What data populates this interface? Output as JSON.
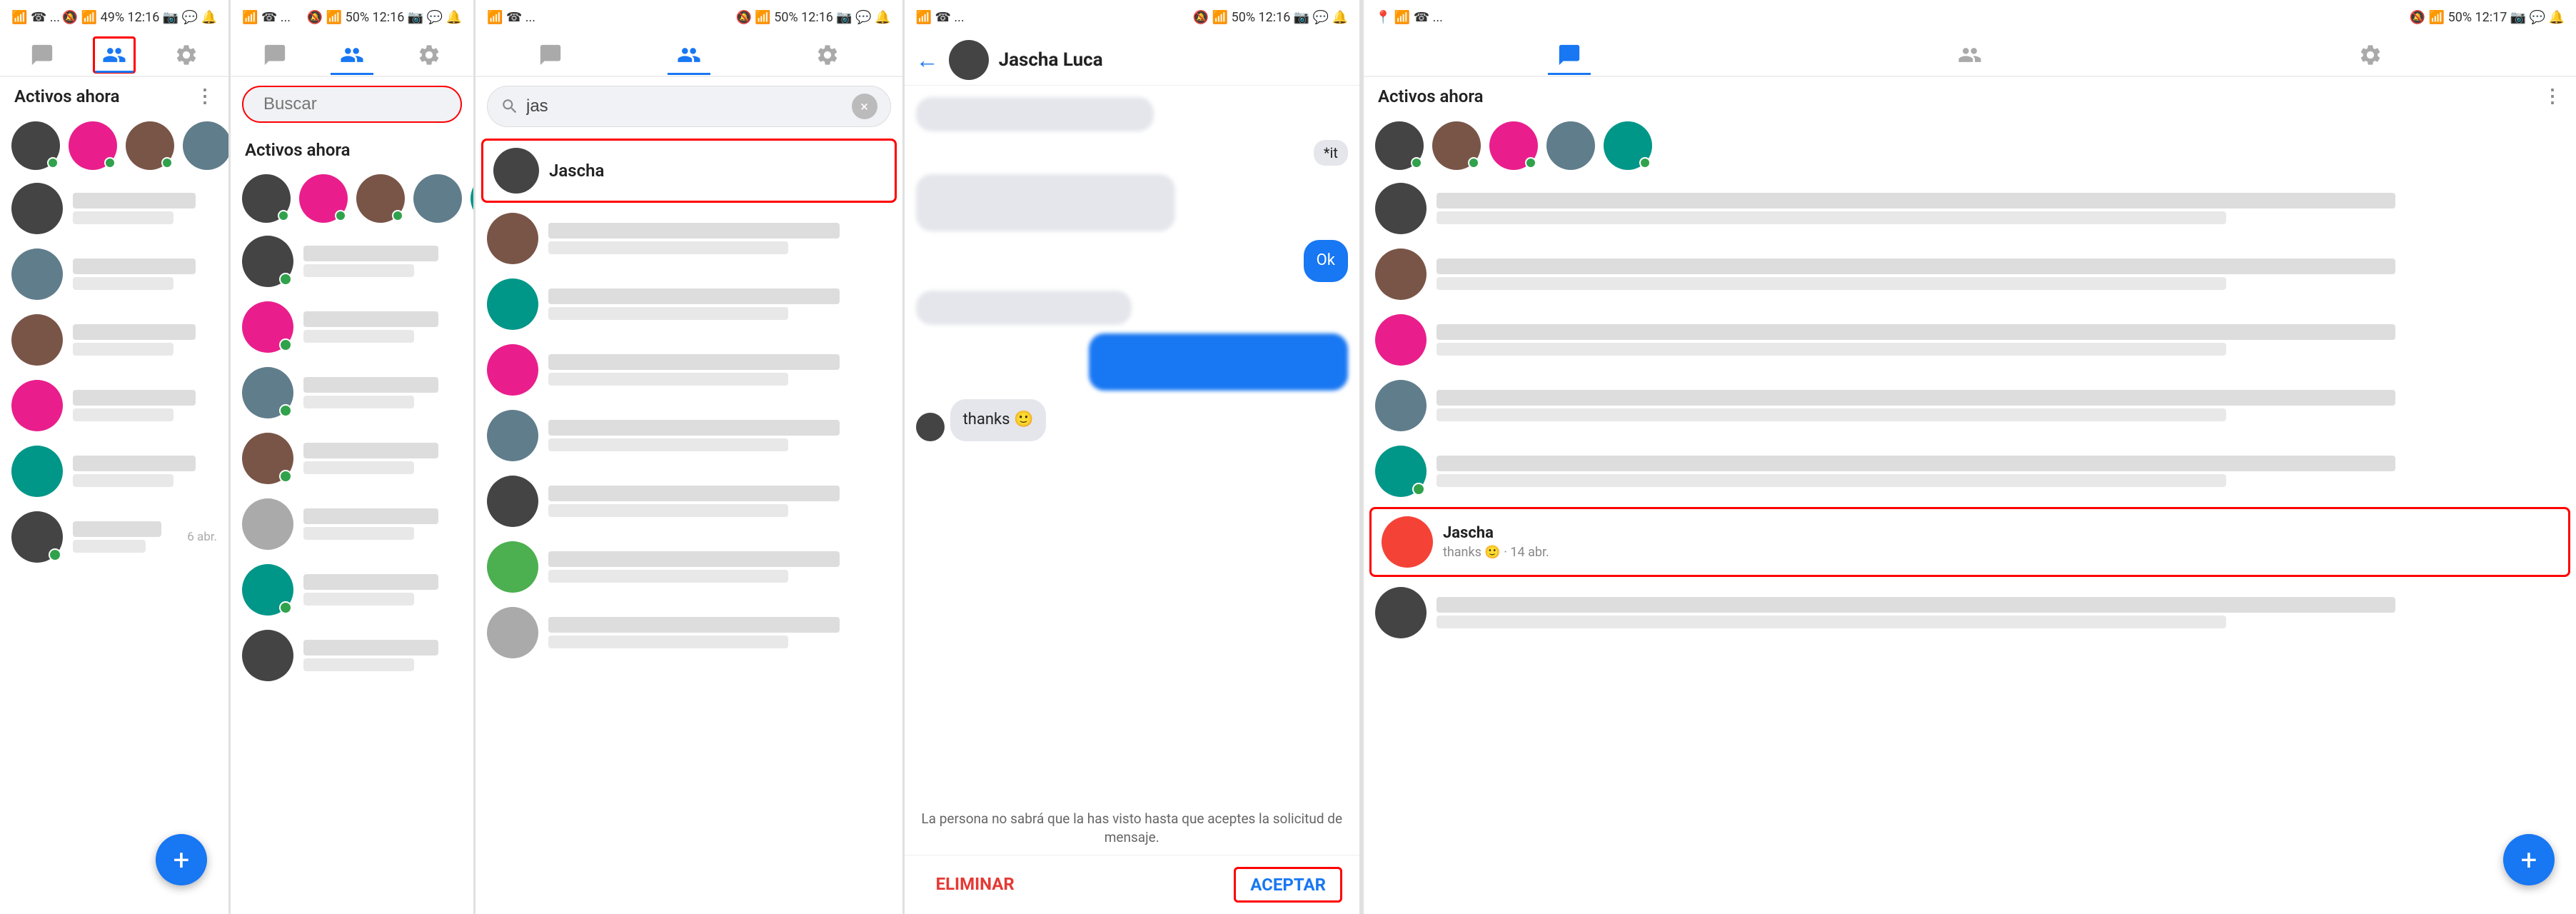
{
  "panel1": {
    "statusBar": {
      "left": "📶 ☎ ...",
      "battery": "49%",
      "time": "12:16",
      "icons": "📷 💬 🔔 ..."
    },
    "tabs": [
      {
        "icon": "chat",
        "active": false
      },
      {
        "icon": "people",
        "active": true,
        "highlighted": true
      },
      {
        "icon": "settings",
        "active": false
      }
    ],
    "sectionTitle": "Activos ahora",
    "activeNow": [
      {
        "color": "av-dark"
      },
      {
        "color": "av-pink"
      },
      {
        "color": "av-brown"
      },
      {
        "color": "av-blue-gray"
      },
      {
        "color": "av-teal"
      }
    ],
    "conversations": [
      {
        "color": "av-dark",
        "hasOnline": false,
        "time": ""
      },
      {
        "color": "av-blue-gray",
        "hasOnline": false,
        "time": ""
      },
      {
        "color": "av-brown",
        "hasOnline": false,
        "time": ""
      },
      {
        "color": "av-pink",
        "hasOnline": false,
        "time": ""
      },
      {
        "color": "av-teal",
        "hasOnline": false,
        "time": ""
      },
      {
        "color": "av-dark",
        "hasOnline": true,
        "time": "6 abr."
      }
    ],
    "fab": "+"
  },
  "panel2": {
    "statusBar": {
      "battery": "50%",
      "time": "12:16"
    },
    "tabs": [
      {
        "icon": "chat",
        "active": false
      },
      {
        "icon": "people",
        "active": true
      },
      {
        "icon": "settings",
        "active": false
      }
    ],
    "search": {
      "placeholder": "Buscar",
      "highlighted": true
    },
    "sectionTitle": "Activos ahora",
    "activeNow": [
      {
        "color": "av-dark"
      },
      {
        "color": "av-pink"
      },
      {
        "color": "av-brown"
      },
      {
        "color": "av-blue-gray"
      },
      {
        "color": "av-teal"
      }
    ],
    "conversations": [
      {
        "color": "av-dark",
        "hasOnline": true
      },
      {
        "color": "av-pink",
        "hasOnline": true
      },
      {
        "color": "av-blue-gray",
        "hasOnline": true
      },
      {
        "color": "av-brown",
        "hasOnline": true
      },
      {
        "color": "av-light",
        "hasOnline": false
      },
      {
        "color": "av-teal",
        "hasOnline": true
      },
      {
        "color": "av-dark",
        "hasOnline": false
      }
    ]
  },
  "panel3": {
    "statusBar": {
      "battery": "50%",
      "time": "12:16"
    },
    "tabs": [
      {
        "icon": "chat",
        "active": false
      },
      {
        "icon": "people",
        "active": true
      },
      {
        "icon": "settings",
        "active": false
      }
    ],
    "search": {
      "value": "jas",
      "clearBtn": "×"
    },
    "searchResults": [
      {
        "name": "Jascha",
        "color": "av-dark",
        "highlighted": true
      },
      {
        "name": "",
        "color": "av-brown"
      },
      {
        "name": "",
        "color": "av-teal"
      },
      {
        "name": "",
        "color": "av-pink"
      },
      {
        "name": "",
        "color": "av-blue-gray"
      },
      {
        "name": "",
        "color": "av-dark"
      },
      {
        "name": "",
        "color": "av-green"
      },
      {
        "name": "",
        "color": "av-light"
      }
    ]
  },
  "panel4": {
    "statusBar": {
      "battery": "50%",
      "time": "12:16"
    },
    "header": {
      "backIcon": "←",
      "name": "Jascha Luca",
      "avatarColor": "av-dark"
    },
    "messages": [
      {
        "type": "received-gray",
        "text": "",
        "height": 48
      },
      {
        "type": "sent-blue",
        "text": "*it"
      },
      {
        "type": "received-gray-lg",
        "text": "",
        "height": 80
      },
      {
        "type": "sent-blue",
        "text": "Ok"
      },
      {
        "type": "received-gray",
        "text": "",
        "height": 48
      },
      {
        "type": "sent-blue-lg",
        "text": ""
      },
      {
        "type": "received-text",
        "text": "thanks 🙂"
      }
    ],
    "privacyNotice": "La persona no sabrá que la has visto hasta que aceptes la solicitud de mensaje.",
    "actions": {
      "delete": "ELIMINAR",
      "accept": "ACEPTAR"
    }
  },
  "panel5": {
    "statusBar": {
      "battery": "50%",
      "time": "12:17",
      "locationIcon": "📍"
    },
    "tabs": [
      {
        "icon": "chat",
        "active": true
      },
      {
        "icon": "people",
        "active": false
      },
      {
        "icon": "settings",
        "active": false
      }
    ],
    "sectionTitle": "Activos ahora",
    "activeNow": [
      {
        "color": "av-dark"
      },
      {
        "color": "av-brown"
      },
      {
        "color": "av-pink"
      },
      {
        "color": "av-blue-gray"
      },
      {
        "color": "av-teal"
      }
    ],
    "conversations": [
      {
        "color": "av-dark",
        "hasOnline": false,
        "name": "",
        "preview": "",
        "time": ""
      },
      {
        "color": "av-brown",
        "hasOnline": false,
        "name": "",
        "preview": "",
        "time": ""
      },
      {
        "color": "av-pink",
        "hasOnline": false,
        "name": "",
        "preview": "",
        "time": ""
      },
      {
        "color": "av-blue-gray",
        "hasOnline": false,
        "name": "",
        "preview": "",
        "time": ""
      },
      {
        "color": "av-teal",
        "hasOnline": true,
        "name": "",
        "preview": "",
        "time": ""
      },
      {
        "color": "av-red",
        "hasOnline": false,
        "name": "Jascha",
        "preview": "thanks 🙂 · 14 abr.",
        "time": "",
        "highlighted": true
      },
      {
        "color": "av-dark",
        "hasOnline": false,
        "name": "",
        "preview": "",
        "time": ""
      }
    ],
    "fab": "+"
  }
}
